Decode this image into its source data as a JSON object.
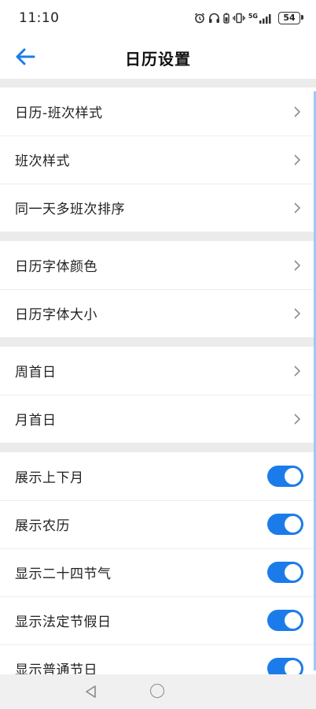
{
  "status_bar": {
    "time": "11:10",
    "network": "5G",
    "battery": "54"
  },
  "header": {
    "title": "日历设置"
  },
  "sections": [
    {
      "items": [
        {
          "label": "日历-班次样式",
          "control": "chevron"
        },
        {
          "label": "班次样式",
          "control": "chevron"
        },
        {
          "label": "同一天多班次排序",
          "control": "chevron"
        }
      ]
    },
    {
      "items": [
        {
          "label": "日历字体颜色",
          "control": "chevron"
        },
        {
          "label": "日历字体大小",
          "control": "chevron"
        }
      ]
    },
    {
      "items": [
        {
          "label": "周首日",
          "control": "chevron"
        },
        {
          "label": "月首日",
          "control": "chevron"
        }
      ]
    },
    {
      "items": [
        {
          "label": "展示上下月",
          "control": "toggle",
          "on": true
        },
        {
          "label": "展示农历",
          "control": "toggle",
          "on": true
        },
        {
          "label": "显示二十四节气",
          "control": "toggle",
          "on": true
        },
        {
          "label": "显示法定节假日",
          "control": "toggle",
          "on": true
        },
        {
          "label": "显示普通节日",
          "control": "toggle",
          "on": true
        }
      ]
    }
  ],
  "colors": {
    "accent": "#1b7ce9",
    "background": "#ebebeb"
  }
}
